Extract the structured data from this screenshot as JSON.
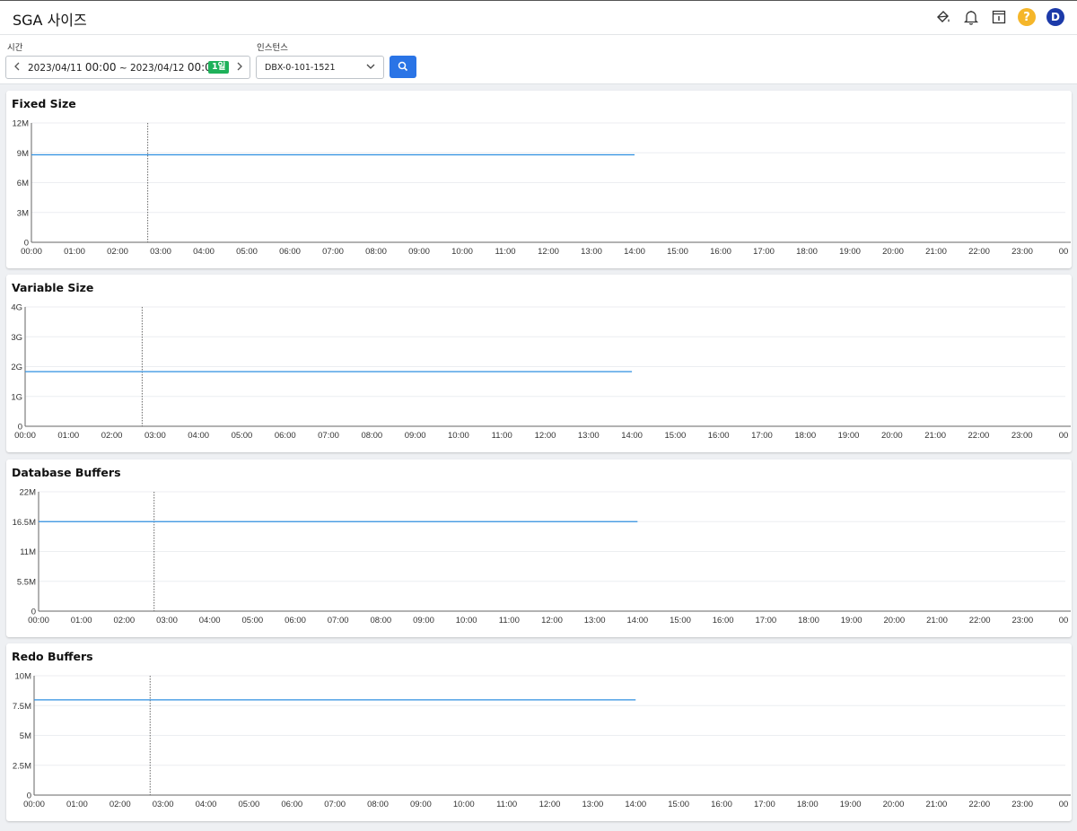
{
  "header": {
    "title": "SGA 사이즈",
    "icons": [
      "paint-bucket-icon",
      "bell-icon",
      "info-box-icon",
      "help-icon",
      "avatar"
    ],
    "help_label": "?",
    "avatar_initial": "D"
  },
  "filters": {
    "time_label": "시간",
    "start_date": "2023/04/11",
    "start_time": "00:00",
    "separator": "~",
    "end_date": "2023/04/12",
    "end_time": "00:00",
    "range_badge": "1일",
    "instance_label": "인스턴스",
    "instance_value": "DBX-0-101-1521",
    "accent_color": "#2a74e6",
    "badge_color": "#1eb15a"
  },
  "x_ticks": [
    "00:00",
    "01:00",
    "02:00",
    "03:00",
    "04:00",
    "05:00",
    "06:00",
    "07:00",
    "08:00",
    "09:00",
    "10:00",
    "11:00",
    "12:00",
    "13:00",
    "14:00",
    "15:00",
    "16:00",
    "17:00",
    "18:00",
    "19:00",
    "20:00",
    "21:00",
    "22:00",
    "23:00",
    "00"
  ],
  "chart_data": [
    {
      "type": "line",
      "title": "Fixed Size",
      "y_ticks": [
        "0",
        "3M",
        "6M",
        "9M",
        "12M"
      ],
      "ylim": [
        0,
        12
      ],
      "y_unit": "M",
      "series": [
        {
          "values": [
            {
              "x": "00:00",
              "y": 8.8
            },
            {
              "x": "14:00",
              "y": 8.8
            }
          ]
        }
      ],
      "marker_time": "02:42",
      "line_color": "#2f8fe0"
    },
    {
      "type": "line",
      "title": "Variable Size",
      "y_ticks": [
        "0",
        "1G",
        "2G",
        "3G",
        "4G"
      ],
      "ylim": [
        0,
        4
      ],
      "y_unit": "G",
      "series": [
        {
          "values": [
            {
              "x": "00:00",
              "y": 1.83
            },
            {
              "x": "14:00",
              "y": 1.83
            }
          ]
        }
      ],
      "marker_time": "02:42",
      "line_color": "#2f8fe0"
    },
    {
      "type": "line",
      "title": "Database Buffers",
      "y_ticks": [
        "0",
        "5.5M",
        "11M",
        "16.5M",
        "22M"
      ],
      "ylim": [
        0,
        22
      ],
      "y_unit": "M",
      "series": [
        {
          "values": [
            {
              "x": "00:00",
              "y": 16.5
            },
            {
              "x": "14:00",
              "y": 16.5
            }
          ]
        }
      ],
      "marker_time": "02:42",
      "line_color": "#2f8fe0"
    },
    {
      "type": "line",
      "title": "Redo Buffers",
      "y_ticks": [
        "0",
        "2.5M",
        "5M",
        "7.5M",
        "10M"
      ],
      "ylim": [
        0,
        10
      ],
      "y_unit": "M",
      "series": [
        {
          "values": [
            {
              "x": "00:00",
              "y": 7.98
            },
            {
              "x": "14:00",
              "y": 7.98
            }
          ]
        }
      ],
      "marker_time": "02:42",
      "line_color": "#2f8fe0"
    }
  ]
}
